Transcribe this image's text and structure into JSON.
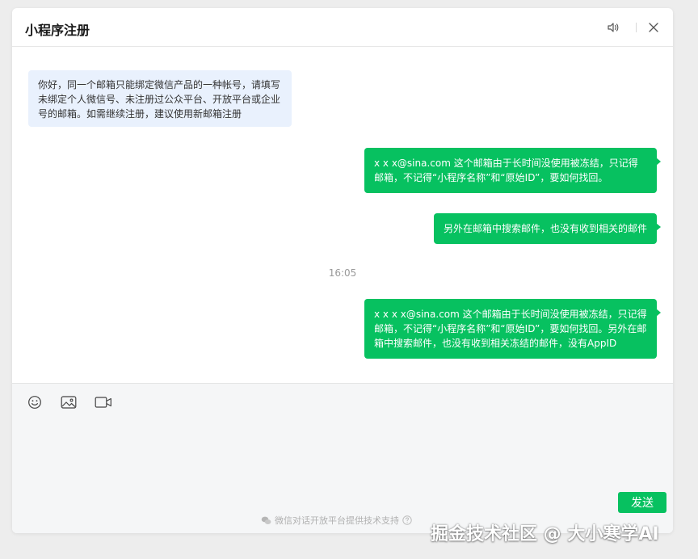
{
  "window": {
    "title": "小程序注册",
    "icons": {
      "sound": "speaker-icon",
      "close": "close-icon"
    }
  },
  "messages": [
    {
      "direction": "in",
      "text": "你好，同一个邮箱只能绑定微信产品的一种帐号，请填写未绑定个人微信号、未注册过公众平台、开放平台或企业号的邮箱。如需继续注册，建议使用新邮箱注册"
    },
    {
      "direction": "out",
      "text": "x x x@sina.com 这个邮箱由于长时间没使用被冻结，只记得邮箱，不记得“小程序名称”和“原始ID”，要如何找回。"
    },
    {
      "direction": "out",
      "text": "另外在邮箱中搜索邮件，也没有收到相关的邮件"
    },
    {
      "direction": "out",
      "text": "x x x x@sina.com 这个邮箱由于长时间没使用被冻结，只记得邮箱，不记得“小程序名称”和“原始ID”，要如何找回。另外在邮箱中搜索邮件，也没有收到相关冻结的邮件，没有AppID"
    }
  ],
  "timestamp": "16:05",
  "toolbar": {
    "emoji_icon": "emoji-icon",
    "image_icon": "image-icon",
    "video_icon": "video-icon"
  },
  "send_label": "发送",
  "footer_text": "微信对话开放平台提供技术支持",
  "watermark": "掘金技术社区 @ 大小寒学AI",
  "colors": {
    "accent": "#07c160",
    "incoming_bubble": "#e9f1fd"
  }
}
